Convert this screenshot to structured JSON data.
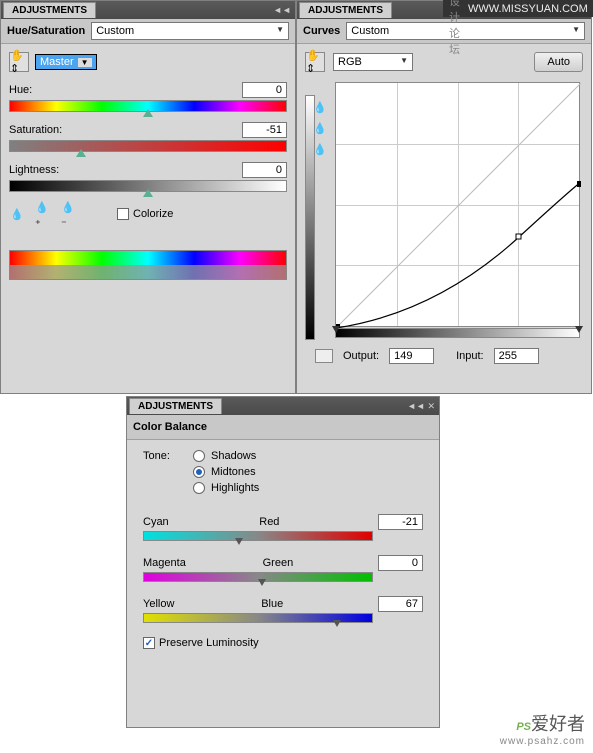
{
  "watermark": {
    "forum": "思缘设计论坛",
    "forum_url": "WWW.MISSYUAN.COM",
    "brand": "PS",
    "brand_cn": "爱好者",
    "brand_url": "www.psahz.com"
  },
  "hue_sat": {
    "tab": "ADJUSTMENTS",
    "title": "Hue/Saturation",
    "preset": "Custom",
    "channel": "Master",
    "labels": {
      "hue": "Hue:",
      "sat": "Saturation:",
      "light": "Lightness:",
      "colorize": "Colorize"
    },
    "values": {
      "hue": 0,
      "sat": -51,
      "light": 0
    }
  },
  "curves": {
    "tab": "ADJUSTMENTS",
    "title": "Curves",
    "preset": "Custom",
    "channel": "RGB",
    "auto": "Auto",
    "output_label": "Output:",
    "input_label": "Input:",
    "output": 149,
    "input": 255
  },
  "color_balance": {
    "tab": "ADJUSTMENTS",
    "title": "Color Balance",
    "tone_label": "Tone:",
    "tones": {
      "shadows": "Shadows",
      "midtones": "Midtones",
      "highlights": "Highlights"
    },
    "selected": "midtones",
    "sliders": [
      {
        "left": "Cyan",
        "right": "Red",
        "value": -21
      },
      {
        "left": "Magenta",
        "right": "Green",
        "value": 0
      },
      {
        "left": "Yellow",
        "right": "Blue",
        "value": 67
      }
    ],
    "preserve": "Preserve Luminosity"
  },
  "chart_data": {
    "type": "line",
    "title": "Curves",
    "xlabel": "Input",
    "ylabel": "Output",
    "xlim": [
      0,
      255
    ],
    "ylim": [
      0,
      255
    ],
    "series": [
      {
        "name": "identity",
        "x": [
          0,
          255
        ],
        "values": [
          0,
          255
        ]
      },
      {
        "name": "curve",
        "x": [
          0,
          64,
          128,
          191,
          255
        ],
        "values": [
          0,
          18,
          50,
          95,
          149
        ]
      }
    ]
  }
}
